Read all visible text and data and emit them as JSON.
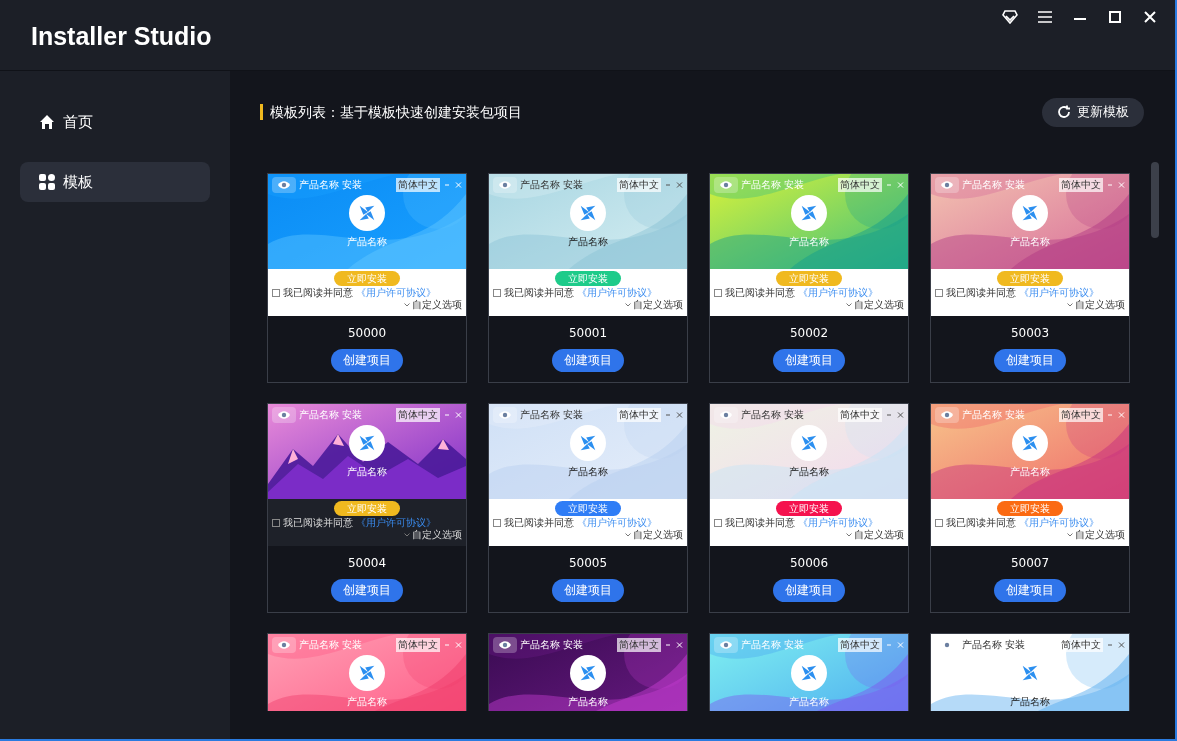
{
  "app": {
    "title": "Installer Studio"
  },
  "sidebar": {
    "items": [
      {
        "label": "首页",
        "selected": false
      },
      {
        "label": "模板",
        "selected": true
      }
    ]
  },
  "header": {
    "title": "模板列表：基于模板快速创建安装包项目",
    "refresh_button": "更新模板"
  },
  "templates": [
    {
      "window_title": "产品名称 安装",
      "language": "简体中文",
      "product_name": "产品名称",
      "install_button": "立即安装",
      "color": "#f0b91f",
      "checked": false,
      "agreement": "我已阅读并同意",
      "agreement_link": "《用户许可协议》",
      "options": "自定义选项",
      "id": "50000",
      "create_button": "创建项目"
    },
    {
      "window_title": "产品名称 安装",
      "language": "简体中文",
      "product_name": "产品名称",
      "install_button": "立即安装",
      "color": "#1ecb8a",
      "checked": false,
      "agreement": "我已阅读并同意",
      "agreement_link": "《用户许可协议》",
      "options": "自定义选项",
      "id": "50001",
      "create_button": "创建项目"
    },
    {
      "window_title": "产品名称 安装",
      "language": "简体中文",
      "product_name": "产品名称",
      "install_button": "立即安装",
      "color": "#f0b91f",
      "checked": false,
      "agreement": "我已阅读并同意",
      "agreement_link": "《用户许可协议》",
      "options": "自定义选项",
      "id": "50002",
      "create_button": "创建项目"
    },
    {
      "window_title": "产品名称 安装",
      "language": "简体中文",
      "product_name": "产品名称",
      "install_button": "立即安装",
      "color": "#f0b91f",
      "checked": false,
      "agreement": "我已阅读并同意",
      "agreement_link": "《用户许可协议》",
      "options": "自定义选项",
      "id": "50003",
      "create_button": "创建项目"
    },
    {
      "window_title": "产品名称 安装",
      "language": "简体中文",
      "product_name": "产品名称",
      "install_button": "立即安装",
      "color": "#f0b91f",
      "checked": false,
      "agreement": "我已阅读并同意",
      "agreement_link": "《用户许可协议》",
      "options": "自定义选项",
      "id": "50004",
      "create_button": "创建项目"
    },
    {
      "window_title": "产品名称 安装",
      "language": "简体中文",
      "product_name": "产品名称",
      "install_button": "立即安装",
      "color": "#2f7df6",
      "checked": false,
      "agreement": "我已阅读并同意",
      "agreement_link": "《用户许可协议》",
      "options": "自定义选项",
      "id": "50005",
      "create_button": "创建项目"
    },
    {
      "window_title": "产品名称 安装",
      "language": "简体中文",
      "product_name": "产品名称",
      "install_button": "立即安装",
      "color": "#f5124e",
      "checked": false,
      "agreement": "我已阅读并同意",
      "agreement_link": "《用户许可协议》",
      "options": "自定义选项",
      "id": "50006",
      "create_button": "创建项目"
    },
    {
      "window_title": "产品名称 安装",
      "language": "简体中文",
      "product_name": "产品名称",
      "install_button": "立即安装",
      "color": "#fb6a12",
      "checked": false,
      "agreement": "我已阅读并同意",
      "agreement_link": "《用户许可协议》",
      "options": "自定义选项",
      "id": "50007",
      "create_button": "创建项目"
    },
    {
      "window_title": "产品名称 安装",
      "language": "简体中文",
      "product_name": "产品名称"
    },
    {
      "window_title": "产品名称 安装",
      "language": "简体中文",
      "product_name": "产品名称"
    },
    {
      "window_title": "产品名称 安装",
      "language": "简体中文",
      "product_name": "产品名称"
    },
    {
      "window_title": "产品名称 安装",
      "language": "简体中文",
      "product_name": "产品名称"
    }
  ]
}
